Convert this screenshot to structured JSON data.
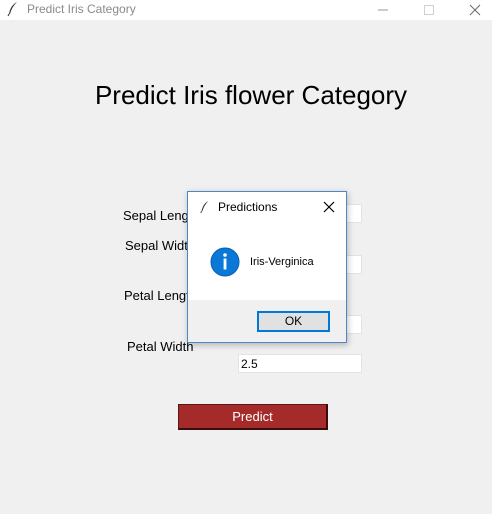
{
  "window": {
    "title": "Predict Iris Category",
    "controls": [
      "minimize-icon",
      "maximize-icon",
      "close-icon"
    ]
  },
  "heading": "Predict Iris flower Category",
  "form": {
    "sepal_length_label": "Sepal Length",
    "sepal_width_label": "Sepal Width",
    "petal_length_label": "Petal Length",
    "petal_width_label": "Petal Width",
    "sepal_length_value": "",
    "sepal_width_value": "",
    "petal_length_value": "",
    "petal_width_value": "2.5",
    "predict_label": "Predict"
  },
  "dialog": {
    "title": "Predictions",
    "message": "Iris-Verginica",
    "ok_label": "OK",
    "icon": "info-icon"
  },
  "colors": {
    "predict_button": "#a52a2a",
    "dialog_border": "#4a88c8",
    "info_icon": "#0a78d7",
    "ok_focus": "#0078d7"
  }
}
